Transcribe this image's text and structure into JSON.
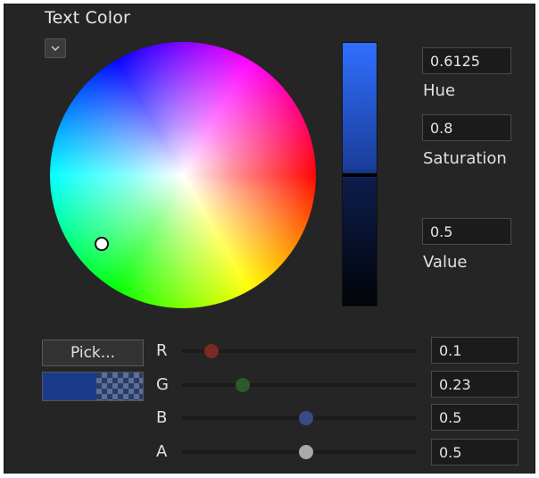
{
  "panel": {
    "title": "Text Color"
  },
  "wheel": {
    "hue": 0.6125,
    "saturation": 0.8
  },
  "value_strip": {
    "value": 0.5
  },
  "fields": {
    "hue": {
      "value": "0.6125",
      "label": "Hue"
    },
    "saturation": {
      "value": "0.8",
      "label": "Saturation"
    },
    "value": {
      "value": "0.5",
      "label": "Value"
    }
  },
  "pick_button": {
    "label": "Pick..."
  },
  "swatch": {
    "color": "#1a3b8a"
  },
  "channels": [
    {
      "label": "R",
      "value": "0.1",
      "level": 0.1,
      "color": "#7a2a22"
    },
    {
      "label": "G",
      "value": "0.23",
      "level": 0.23,
      "color": "#2c5a2a"
    },
    {
      "label": "B",
      "value": "0.5",
      "level": 0.5,
      "color": "#3b4a8a"
    },
    {
      "label": "A",
      "value": "0.5",
      "level": 0.5,
      "color": "#a9a9a9"
    }
  ],
  "icons": {
    "collapse": "chevron-down-icon"
  }
}
